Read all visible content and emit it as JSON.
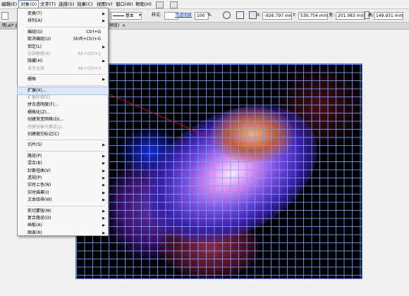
{
  "menubar": {
    "items": [
      {
        "label": "编辑(E)",
        "active": false
      },
      {
        "label": "对象(O)",
        "active": true
      },
      {
        "label": "文字(T)",
        "active": false
      },
      {
        "label": "选择(S)",
        "active": false
      },
      {
        "label": "效果(C)",
        "active": false
      },
      {
        "label": "视图(V)",
        "active": false
      },
      {
        "label": "窗口(W)",
        "active": false
      },
      {
        "label": "帮助(H)",
        "active": false
      }
    ]
  },
  "control_bar": {
    "stroke_style_label": "基本",
    "style_label": "样式:",
    "opacity_label": "不透明度",
    "opacity_value": "100",
    "opacity_unit": "%",
    "x_label": "X:",
    "x_value": "-926.797 mm",
    "y_label": "Y:",
    "y_value": "530.754 mm",
    "w_label": "宽:",
    "w_value": "201.083 mm",
    "h_label": "高:",
    "h_value": "149.931 mm"
  },
  "tabs": {
    "doc_tab_left": "明.ai* @",
    "doc_tab_right": "预览)"
  },
  "object_menu": [
    {
      "label": "变换(T)",
      "shortcut": "",
      "submenu": true,
      "disabled": false
    },
    {
      "label": "排列(A)",
      "shortcut": "",
      "submenu": true,
      "disabled": false
    },
    {
      "sep": true
    },
    {
      "label": "编组(G)",
      "shortcut": "Ctrl+G",
      "submenu": false,
      "disabled": false
    },
    {
      "label": "取消编组(U)",
      "shortcut": "Shift+Ctrl+G",
      "submenu": false,
      "disabled": false
    },
    {
      "label": "锁定(L)",
      "shortcut": "",
      "submenu": true,
      "disabled": false
    },
    {
      "label": "全部解锁(K)",
      "shortcut": "Alt+Ctrl+2",
      "submenu": false,
      "disabled": true
    },
    {
      "label": "隐藏(H)",
      "shortcut": "",
      "submenu": true,
      "disabled": false
    },
    {
      "label": "显示全部",
      "shortcut": "Alt+Ctrl+3",
      "submenu": false,
      "disabled": true
    },
    {
      "sep": true
    },
    {
      "label": "栅格",
      "shortcut": "",
      "submenu": true,
      "disabled": false
    },
    {
      "sep": true
    },
    {
      "label": "扩展(X)...",
      "shortcut": "",
      "submenu": false,
      "disabled": false,
      "highlight": true
    },
    {
      "label": "扩展外观(E)",
      "shortcut": "",
      "submenu": false,
      "disabled": true
    },
    {
      "label": "拼合透明度(F)...",
      "shortcut": "",
      "submenu": false,
      "disabled": false
    },
    {
      "label": "栅格化(Z)...",
      "shortcut": "",
      "submenu": false,
      "disabled": false
    },
    {
      "label": "创建渐变网格(D)...",
      "shortcut": "",
      "submenu": false,
      "disabled": false
    },
    {
      "label": "创建对象马赛克(J)...",
      "shortcut": "",
      "submenu": false,
      "disabled": true
    },
    {
      "label": "创建裁切标记(C)",
      "shortcut": "",
      "submenu": false,
      "disabled": false
    },
    {
      "sep": true
    },
    {
      "label": "切片(S)",
      "shortcut": "",
      "submenu": true,
      "disabled": false
    },
    {
      "sep": true
    },
    {
      "label": "路径(P)",
      "shortcut": "",
      "submenu": true,
      "disabled": false
    },
    {
      "label": "混合(B)",
      "shortcut": "",
      "submenu": true,
      "disabled": false
    },
    {
      "label": "封套扭曲(V)",
      "shortcut": "",
      "submenu": true,
      "disabled": false
    },
    {
      "label": "透视(P)",
      "shortcut": "",
      "submenu": true,
      "disabled": false
    },
    {
      "label": "实时上色(N)",
      "shortcut": "",
      "submenu": true,
      "disabled": false
    },
    {
      "label": "实时描摹(I)",
      "shortcut": "",
      "submenu": true,
      "disabled": false
    },
    {
      "label": "文本绕排(W)",
      "shortcut": "",
      "submenu": true,
      "disabled": false
    },
    {
      "sep": true
    },
    {
      "label": "剪切蒙版(M)",
      "shortcut": "",
      "submenu": true,
      "disabled": false
    },
    {
      "label": "复合路径(O)",
      "shortcut": "",
      "submenu": true,
      "disabled": false
    },
    {
      "label": "画板(A)",
      "shortcut": "",
      "submenu": true,
      "disabled": false
    },
    {
      "label": "图表(R)",
      "shortcut": "",
      "submenu": true,
      "disabled": false
    }
  ],
  "colors": {
    "accent": "#4a7bd4",
    "annotation": "#d01010",
    "grid": "#78a0ff"
  }
}
